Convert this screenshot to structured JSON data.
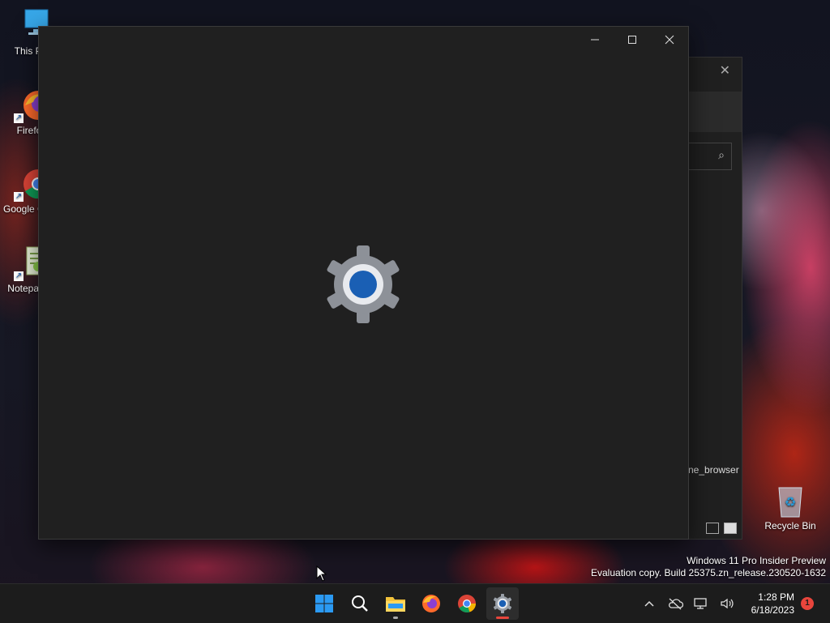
{
  "desktop": {
    "icons": [
      {
        "label": "This PC",
        "icon": "computer-icon"
      },
      {
        "label": "Firefox",
        "icon": "firefox-icon"
      },
      {
        "label": "Google Chrome",
        "icon": "chrome-icon"
      },
      {
        "label": "Notepad++",
        "icon": "notepad-icon"
      },
      {
        "label": "Recycle Bin",
        "icon": "recycle-bin-icon"
      }
    ]
  },
  "background_window": {
    "visible_filename": "ne_browser",
    "search_icon": "search-icon",
    "close_icon": "close-icon"
  },
  "settings_window": {
    "controls": {
      "minimize": "—",
      "maximize": "☐",
      "close": "✕"
    },
    "splash_icon": "settings-gear-icon",
    "accent": "#1a5fb4"
  },
  "watermark": {
    "line1": "Windows 11 Pro Insider Preview",
    "line2": "Evaluation copy. Build 25375.zn_release.230520-1632"
  },
  "taskbar": {
    "apps": [
      {
        "name": "start",
        "icon": "windows-start-icon"
      },
      {
        "name": "search",
        "icon": "search-icon"
      },
      {
        "name": "file-explorer",
        "icon": "folder-icon",
        "indicator_color": "#aaaaaa"
      },
      {
        "name": "firefox",
        "icon": "firefox-icon"
      },
      {
        "name": "chrome",
        "icon": "chrome-icon"
      },
      {
        "name": "settings",
        "icon": "settings-gear-icon",
        "indicator_color": "#e8453c",
        "active": true
      }
    ],
    "tray": {
      "chevron": "^",
      "time": "1:28 PM",
      "date": "6/18/2023",
      "notification_count": "1"
    }
  }
}
